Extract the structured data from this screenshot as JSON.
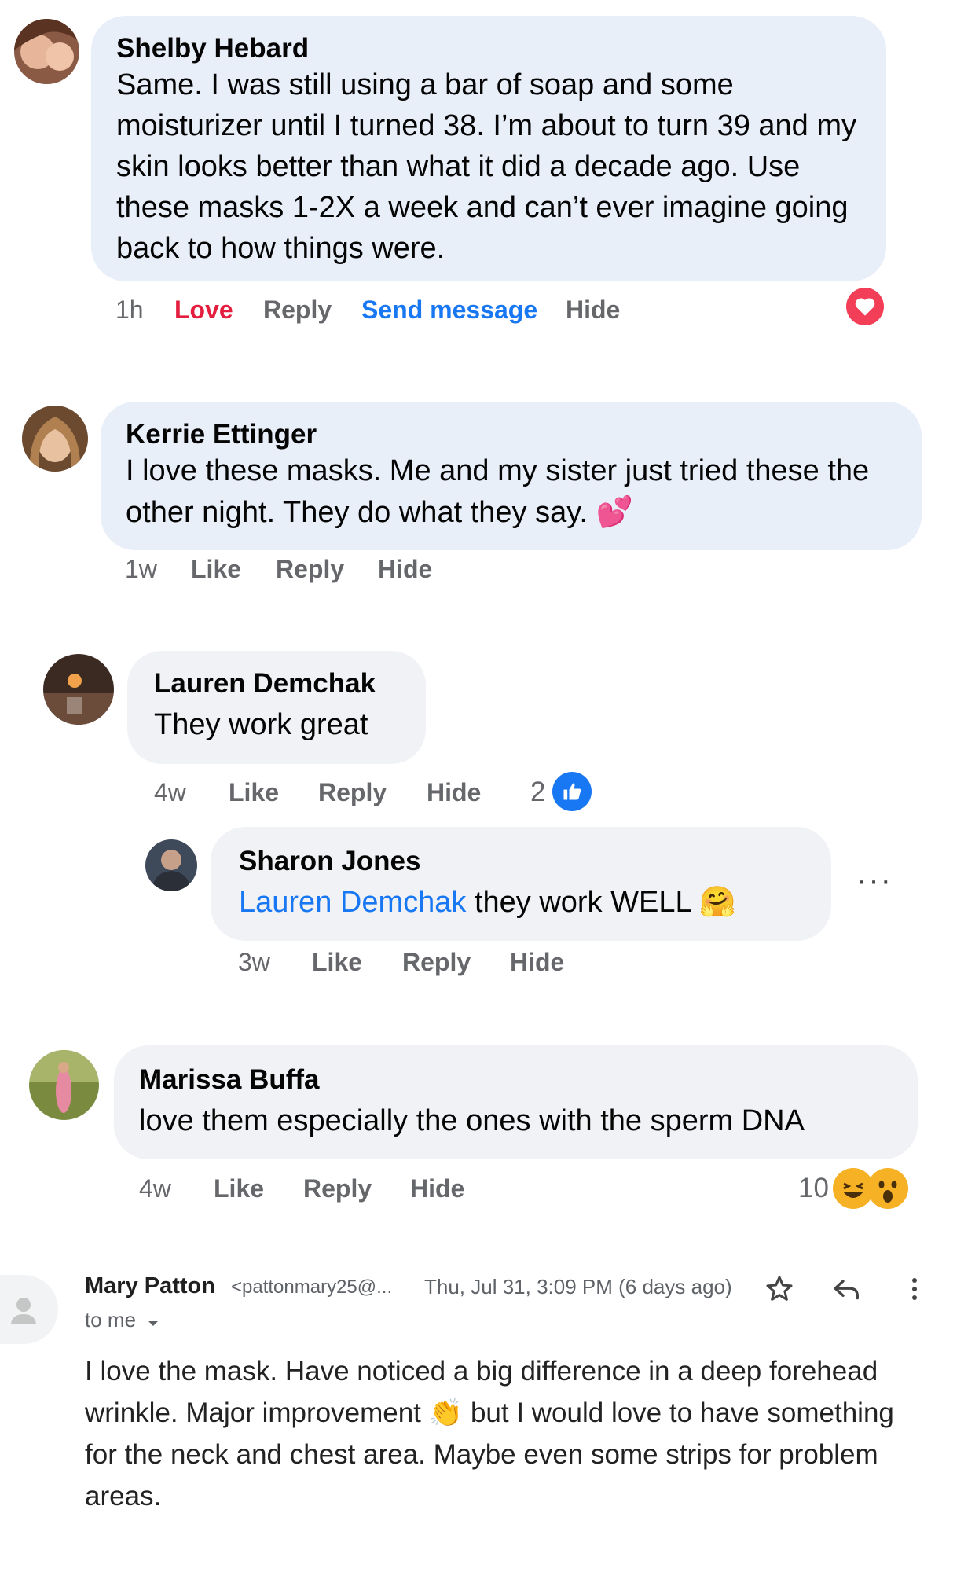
{
  "comments": [
    {
      "name": "Shelby Hebard",
      "text": "Same. I was still using a bar of soap and some moisturizer until I turned 38. I’m about to turn 39 and my skin looks better than what it did a decade ago. Use these masks 1-2X a week and can’t ever imagine going back to how things were.",
      "time": "1h",
      "actions": [
        "Love",
        "Reply",
        "Send message",
        "Hide"
      ],
      "reaction": "heart-icon"
    },
    {
      "name": "Kerrie Ettinger",
      "text": "I love these masks. Me and my sister just tried these the other night. They do what they say.",
      "emoji": "💕",
      "time": "1w",
      "actions": [
        "Like",
        "Reply",
        "Hide"
      ]
    },
    {
      "name": "Lauren Demchak",
      "text": "They work great",
      "time": "4w",
      "actions": [
        "Like",
        "Reply",
        "Hide"
      ],
      "reaction_count": "2",
      "reaction": "like-icon"
    },
    {
      "name": "Sharon Jones",
      "mention": "Lauren Demchak",
      "text": " they work WELL",
      "emoji": "🤗",
      "time": "3w",
      "actions": [
        "Like",
        "Reply",
        "Hide"
      ],
      "more": "···"
    },
    {
      "name": "Marissa Buffa",
      "text": "love them especially the ones with the sperm DNA",
      "time": "4w",
      "actions": [
        "Like",
        "Reply",
        "Hide"
      ],
      "reaction_count": "10",
      "reactions": [
        "haha-icon",
        "wow-icon"
      ]
    }
  ],
  "email": {
    "sender": "Mary Patton",
    "address": "<pattonmary25@...",
    "date": "Thu, Jul 31, 3:09 PM (6 days ago)",
    "to": "to me",
    "body_1": "I love the mask. Have noticed a big difference in a deep forehead wrinkle.  Major improvement ",
    "emoji": "👏",
    "body_2": " but I would love to have something for the neck and chest area. Maybe even some strips for problem areas."
  },
  "colors": {
    "bubble_blue": "#e8eff9",
    "bubble_gray": "#f0f2f5",
    "love_red": "#e41e3f",
    "link_blue": "#1877f2",
    "meta_gray": "#65676b"
  }
}
